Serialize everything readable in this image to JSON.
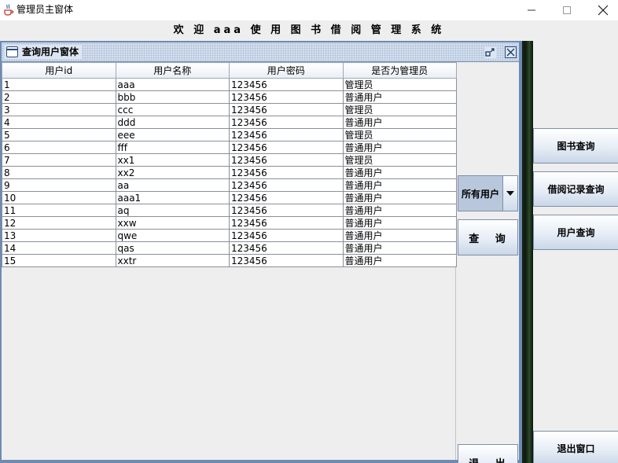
{
  "window": {
    "title": "管理员主窗体",
    "minimize_icon": "minimize-icon",
    "maximize_icon": "maximize-icon",
    "close_icon": "close-icon"
  },
  "welcome_text": "欢 迎 aaa 使 用 图 书 借 阅 管 理 系 统",
  "internal_frame": {
    "title": "查询用户窗体"
  },
  "table": {
    "columns": [
      "用户id",
      "用户名称",
      "用户密码",
      "是否为管理员"
    ],
    "rows": [
      [
        "1",
        "aaa",
        "123456",
        "管理员"
      ],
      [
        "2",
        "bbb",
        "123456",
        "普通用户"
      ],
      [
        "3",
        "ccc",
        "123456",
        "管理员"
      ],
      [
        "4",
        "ddd",
        "123456",
        "普通用户"
      ],
      [
        "5",
        "eee",
        "123456",
        "管理员"
      ],
      [
        "6",
        "fff",
        "123456",
        "普通用户"
      ],
      [
        "7",
        "xx1",
        "123456",
        "管理员"
      ],
      [
        "8",
        "xx2",
        "123456",
        "普通用户"
      ],
      [
        "9",
        "aa",
        "123456",
        "普通用户"
      ],
      [
        "10",
        "aaa1",
        "123456",
        "普通用户"
      ],
      [
        "11",
        "aq",
        "123456",
        "普通用户"
      ],
      [
        "12",
        "xxw",
        "123456",
        "普通用户"
      ],
      [
        "13",
        "qwe",
        "123456",
        "普通用户"
      ],
      [
        "14",
        "qas",
        "123456",
        "普通用户"
      ],
      [
        "15",
        "xxtr",
        "123456",
        "普通用户"
      ]
    ]
  },
  "controls": {
    "filter_selected": "所有用户",
    "query_label": "查 询",
    "exit_label": "退 出"
  },
  "sidebar": {
    "book_query": "图书查询",
    "borrow_record_query": "借阅记录查询",
    "user_query": "用户查询",
    "exit_window": "退出窗口"
  }
}
